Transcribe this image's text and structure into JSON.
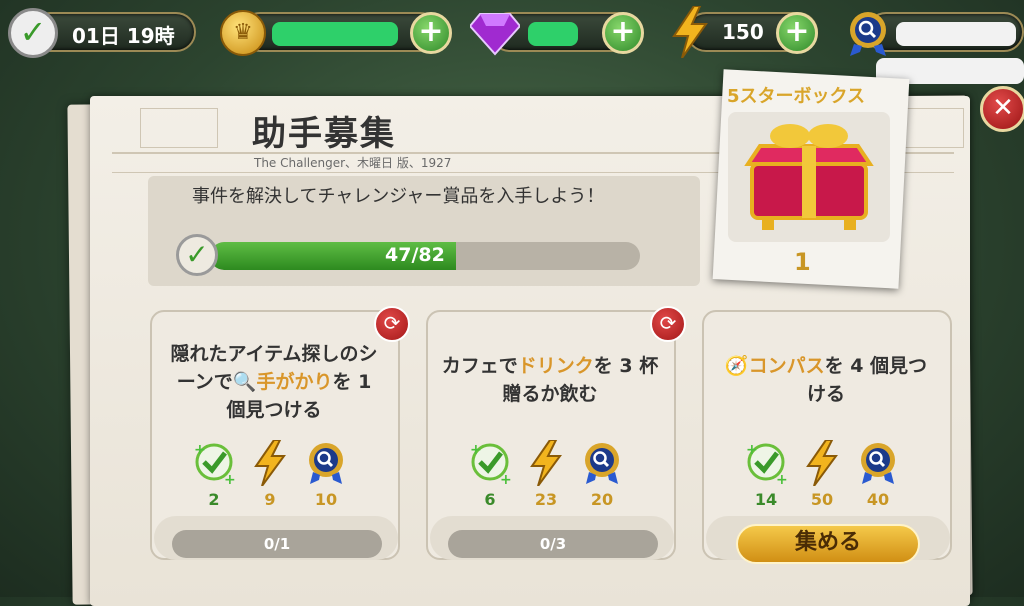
{
  "topbar": {
    "timer": "01日 19時",
    "energy": "150"
  },
  "event": {
    "title": "助手募集",
    "subtitle": "The Challenger、木曜日 版、1927",
    "goal": "事件を解決してチャレンジャー賞品を入手しよう！",
    "progress_text": "47/82",
    "progress_fraction": 0.573
  },
  "reward": {
    "title": "5スターボックス",
    "count": "1"
  },
  "tasks": [
    {
      "text_pre": "隠れたアイテム探しのシーンで",
      "text_hl": "手がかり",
      "text_post": "を 1 個見つける",
      "rewards": [
        "2",
        "9",
        "10"
      ],
      "counter": "0/1"
    },
    {
      "text_pre": "カフェで",
      "text_hl": "ドリンク",
      "text_post": "を 3 杯贈るか飲む",
      "rewards": [
        "6",
        "23",
        "20"
      ],
      "counter": "0/3"
    },
    {
      "text_hl": "コンパス",
      "text_post": "を 4 個見つける",
      "rewards": [
        "14",
        "50",
        "40"
      ],
      "button": "集める"
    }
  ],
  "colors": {
    "accent_gold": "#d9962a",
    "progress_green": "#2d8a1f",
    "close_red": "#c82020"
  }
}
